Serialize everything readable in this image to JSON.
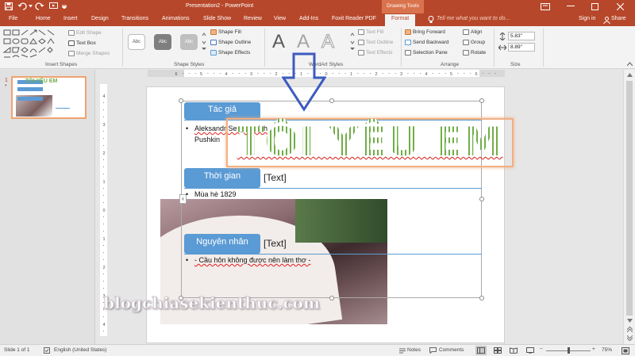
{
  "window": {
    "title": "Presentation2 - PowerPoint",
    "context_tab_group": "Drawing Tools"
  },
  "quick_access": {
    "save_icon": "save-icon",
    "undo_icon": "undo-icon",
    "redo_icon": "redo-icon",
    "start_icon": "presentation-icon"
  },
  "tabs": [
    "File",
    "Home",
    "Insert",
    "Design",
    "Transitions",
    "Animations",
    "Slide Show",
    "Review",
    "View",
    "Add-Ins",
    "Foxit Reader PDF",
    "Format"
  ],
  "active_tab": "Format",
  "tell_me": "Tell me what you want to do...",
  "sign_in": "Sign in",
  "share": "Share",
  "ribbon": {
    "insert_shapes": {
      "label": "Insert Shapes",
      "edit_shape": "Edit Shape",
      "text_box": "Text Box",
      "merge_shapes": "Merge Shapes"
    },
    "shape_styles": {
      "label": "Shape Styles",
      "swatch_text": "Abc",
      "shape_fill": "Shape Fill",
      "shape_outline": "Shape Outline",
      "shape_effects": "Shape Effects"
    },
    "wordart_styles": {
      "label": "WordArt Styles",
      "letter": "A",
      "text_fill": "Text Fill",
      "text_outline": "Text Outline",
      "text_effects": "Text Effects"
    },
    "arrange": {
      "label": "Arrange",
      "bring_forward": "Bring Forward",
      "send_backward": "Send Backward",
      "selection_pane": "Selection Pane",
      "align": "Align",
      "group": "Group",
      "rotate": "Rotate"
    },
    "size": {
      "label": "Size",
      "height": "5.83\"",
      "width": "8.89\""
    }
  },
  "thumbnail": {
    "number": "1",
    "star": "*",
    "mini_title": "TÔI YÊU EM"
  },
  "ruler": {
    "h_ticks": [
      "6",
      "5",
      "4",
      "3",
      "2",
      "1",
      "0",
      "1",
      "2",
      "3",
      "4",
      "5",
      "6"
    ],
    "v_ticks": [
      "4",
      "3",
      "2",
      "1",
      "0",
      "1",
      "2",
      "3",
      "4"
    ]
  },
  "slide": {
    "wordart": "TÔI YÊU EM",
    "smartart": {
      "items": [
        {
          "label": "Tác giả",
          "bullets": [
            "Aleksandr Sergeyevich",
            "Pushkin"
          ]
        },
        {
          "label": "Thời gian",
          "inline": "[Text]",
          "bullets": [
            "Mùa hè 1829"
          ]
        },
        {
          "label": "Nguyên nhân",
          "inline": "[Text]",
          "bullets": [
            "- Cầu hôn không được nên làm thơ -"
          ]
        }
      ],
      "toggle": "‹"
    },
    "watermark": "blogchiasekienthuc.com"
  },
  "status": {
    "slide": "Slide 1 of 1",
    "language": "English (United States)",
    "notes": "Notes",
    "comments": "Comments",
    "zoom_minus": "−",
    "zoom_plus": "+",
    "zoom": "75%",
    "zoom_level": 0.5
  },
  "colors": {
    "accent": "#b7472a",
    "smartart_blue": "#5b9bd5",
    "wordart_green": "#70ad47",
    "callout_arrow": "#3b5bbf"
  }
}
